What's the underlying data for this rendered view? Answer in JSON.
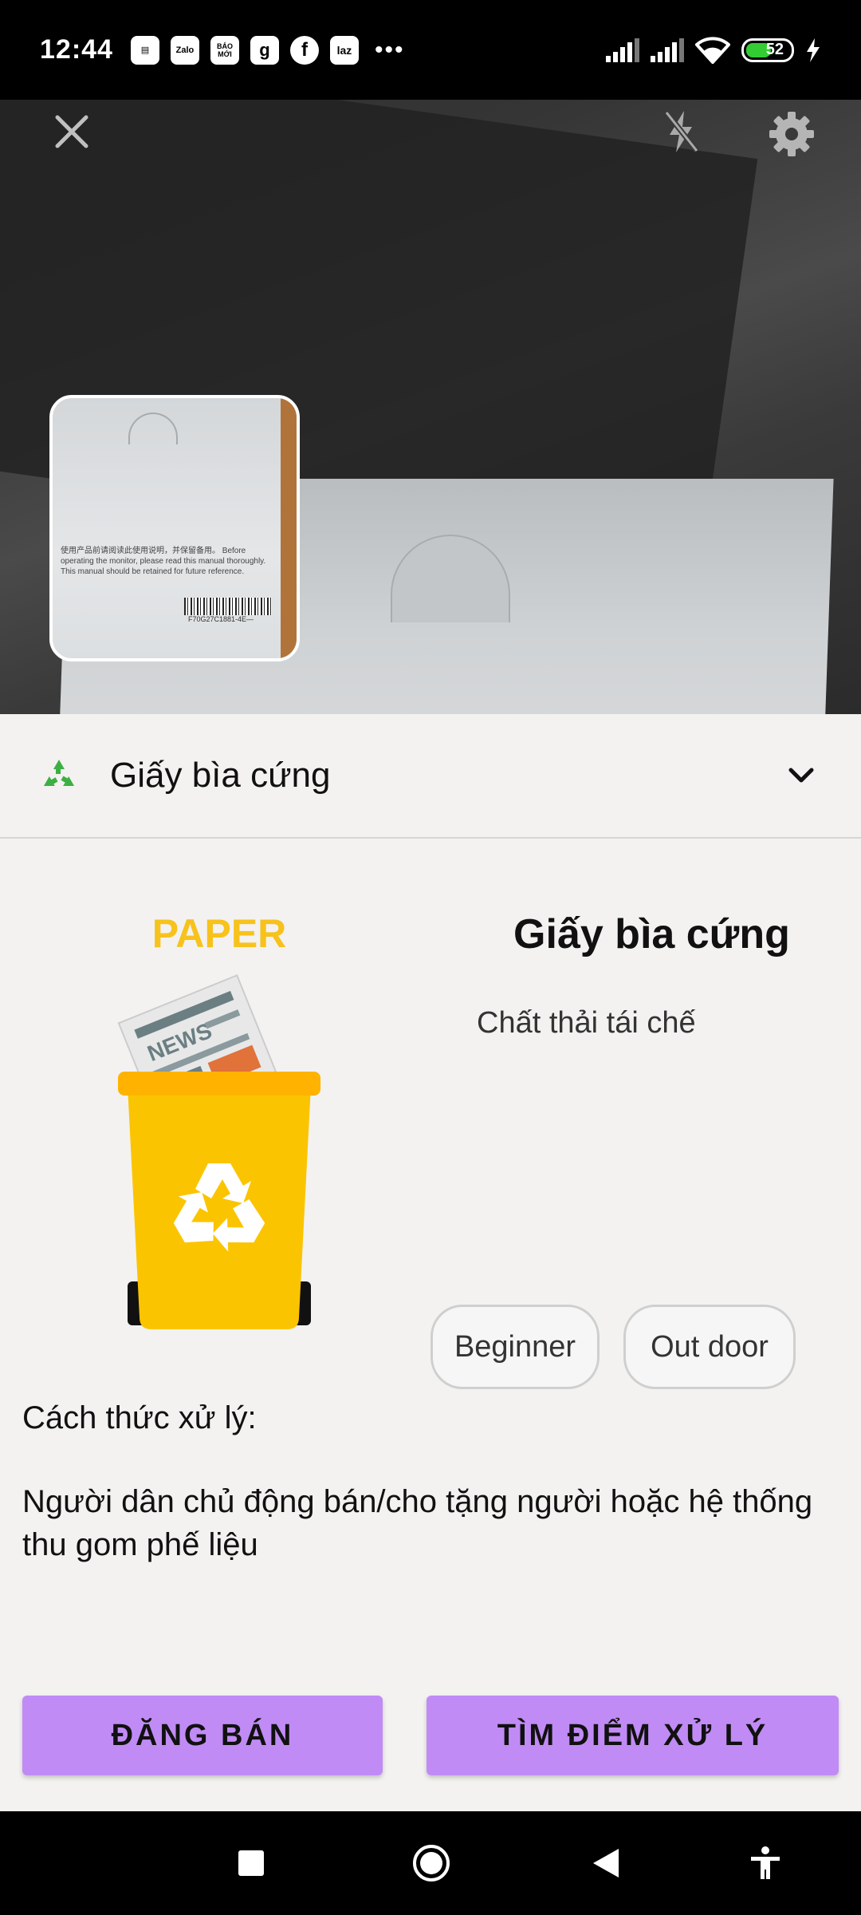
{
  "status_bar": {
    "time": "12:44",
    "apps": [
      {
        "name": "news-app-icon",
        "label": "▤"
      },
      {
        "name": "zalo-icon",
        "label": "Zalo"
      },
      {
        "name": "baomoi-icon",
        "label": "BÁO MỚI"
      },
      {
        "name": "gojek-icon",
        "label": "g"
      },
      {
        "name": "facebook-icon",
        "label": "f"
      },
      {
        "name": "lazada-icon",
        "label": "laz"
      }
    ],
    "more": "•••",
    "battery": "52",
    "battery_level": 0.52
  },
  "camera": {
    "thumb_text": "使用产品前请阅读此使用说明，并保留备用。 Before operating the monitor, please read this manual thoroughly. This manual should be retained for future reference.",
    "thumb_code": "F70G27C1881-4E—"
  },
  "sheet": {
    "title": "Giấy bìa cứng",
    "bin_label": "PAPER",
    "bin_newspaper": "NEWS",
    "material_name": "Giấy bìa cứng",
    "material_type": "Chất thải tái chế",
    "tags": [
      "Beginner",
      "Out door"
    ],
    "method_title": "Cách thức xử lý:",
    "method_text": "Người dân chủ động bán/cho tặng người hoặc hệ thống thu gom phế liệu",
    "buttons": {
      "sell": "ĐĂNG BÁN",
      "find": "TÌM ĐIỂM XỬ LÝ"
    }
  },
  "colors": {
    "accent": "#c18bf5",
    "bin_yellow": "#f7c21c",
    "recycle_green": "#3cb043"
  }
}
